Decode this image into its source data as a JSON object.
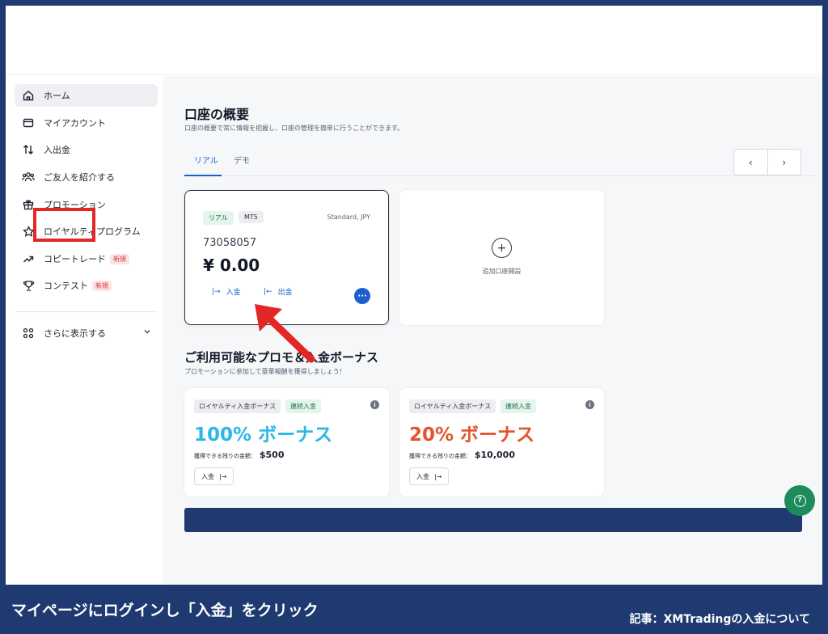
{
  "sidebar": {
    "items": [
      {
        "label": "ホーム",
        "icon": "home-icon"
      },
      {
        "label": "マイアカウント",
        "icon": "wallet-icon"
      },
      {
        "label": "入出金",
        "icon": "transfer-icon"
      },
      {
        "label": "ご友人を紹介する",
        "icon": "users-icon"
      },
      {
        "label": "プロモーション",
        "icon": "gift-icon"
      },
      {
        "label": "ロイヤルティプログラム",
        "icon": "star-icon"
      },
      {
        "label": "コピートレード",
        "icon": "trend-icon",
        "badge": "新規"
      },
      {
        "label": "コンテスト",
        "icon": "trophy-icon",
        "badge": "新規"
      }
    ],
    "more": {
      "label": "さらに表示する",
      "icon": "grid-icon"
    }
  },
  "main": {
    "title": "口座の概要",
    "subtitle": "口座の概要で常に情報を把握し、口座の管理を簡単に行うことができます。",
    "tabs": [
      {
        "label": "リアル",
        "active": true
      },
      {
        "label": "デモ",
        "active": false
      }
    ],
    "pager": {
      "prev": "‹",
      "next": "›"
    },
    "account": {
      "type_badge": "リアル",
      "platform_badge": "MT5",
      "account_type": "Standard, JPY",
      "number": "73058057",
      "balance": "¥ 0.00",
      "deposit_label": "入金",
      "withdraw_label": "出金",
      "more": "···"
    },
    "add_account": {
      "label": "追加口座開設",
      "icon": "+"
    },
    "promos_title": "ご利用可能なプロモ＆入金ボーナス",
    "promos_subtitle": "プロモーションに参加して豪華報酬を獲得しましょう！",
    "promos": [
      {
        "tag1": "ロイヤルティ入金ボーナス",
        "tag2": "連続入金",
        "bonus": "100% ボーナス",
        "color": "#2ab8ea",
        "remaining_label": "獲得できる残りの金額：",
        "remaining_value": "$500",
        "button": "入金"
      },
      {
        "tag1": "ロイヤルティ入金ボーナス",
        "tag2": "連続入金",
        "bonus": "20% ボーナス",
        "color": "#e4532d",
        "remaining_label": "獲得できる残りの金額：",
        "remaining_value": "$10,000",
        "button": "入金"
      }
    ]
  },
  "colors": {
    "accent": "#1c5fd1",
    "frame": "#1e3a70",
    "highlight": "#e32626",
    "help": "#1d8b5c"
  },
  "caption": "マイページにログインし「入金」をクリック",
  "article": "記事：XMTradingの入金について"
}
